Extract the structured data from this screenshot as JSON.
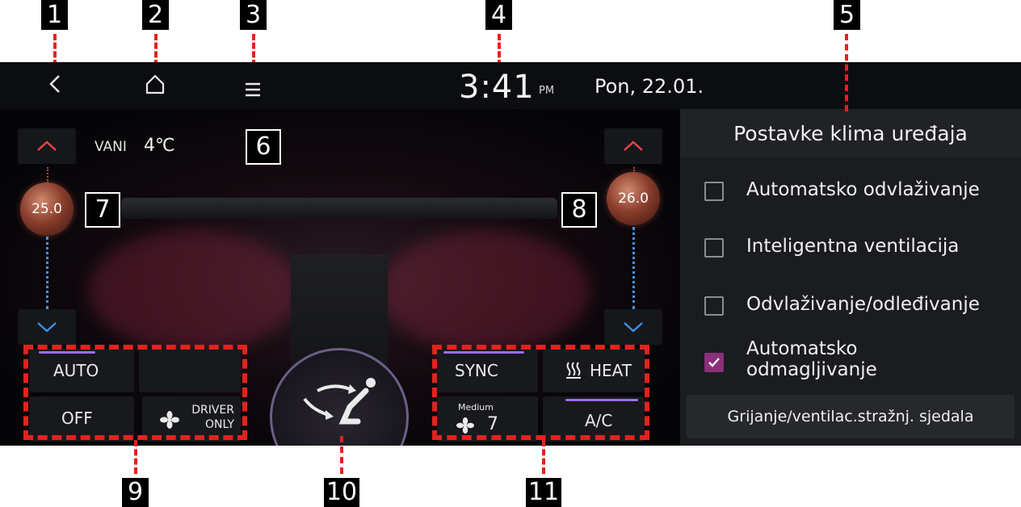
{
  "callouts": {
    "n1": "1",
    "n2": "2",
    "n3": "3",
    "n4": "4",
    "n5": "5",
    "n6": "6",
    "n7": "7",
    "n8": "8",
    "n9": "9",
    "n10": "10",
    "n11": "11"
  },
  "topbar": {
    "back_icon": "back-chevron-icon",
    "home_icon": "home-icon",
    "menu_icon": "menu-icon",
    "time": "3:41",
    "ampm": "PM",
    "date": "Pon, 22.01."
  },
  "climate": {
    "outside_label": "VANI",
    "outside_temp": "4℃",
    "driver_temp": "25.0",
    "passenger_temp": "26.0",
    "left_controls": {
      "auto": "AUTO",
      "off": "OFF",
      "driver_only_line1": "DRIVER",
      "driver_only_line2": "ONLY"
    },
    "right_controls": {
      "sync": "SYNC",
      "heat": "HEAT",
      "fan_mode": "Medium",
      "fan_speed": "7",
      "ac": "A/C"
    },
    "colors": {
      "temp_up_arrow": "#e84545",
      "temp_down_arrow": "#3f8de8",
      "active_indicator": "#9b6cf0"
    }
  },
  "panel": {
    "title": "Postavke klima uređaja",
    "options": [
      {
        "label": "Automatsko odvlaživanje",
        "checked": false
      },
      {
        "label": "Inteligentna ventilacija",
        "checked": false
      },
      {
        "label": "Odvlaživanje/odleđivanje",
        "checked": false
      },
      {
        "label": "Automatsko odmagljivanje",
        "checked": true
      }
    ],
    "seat_button": "Grijanje/ventilac.stražnj. sjedala",
    "check_color": "#8a2f7a"
  }
}
